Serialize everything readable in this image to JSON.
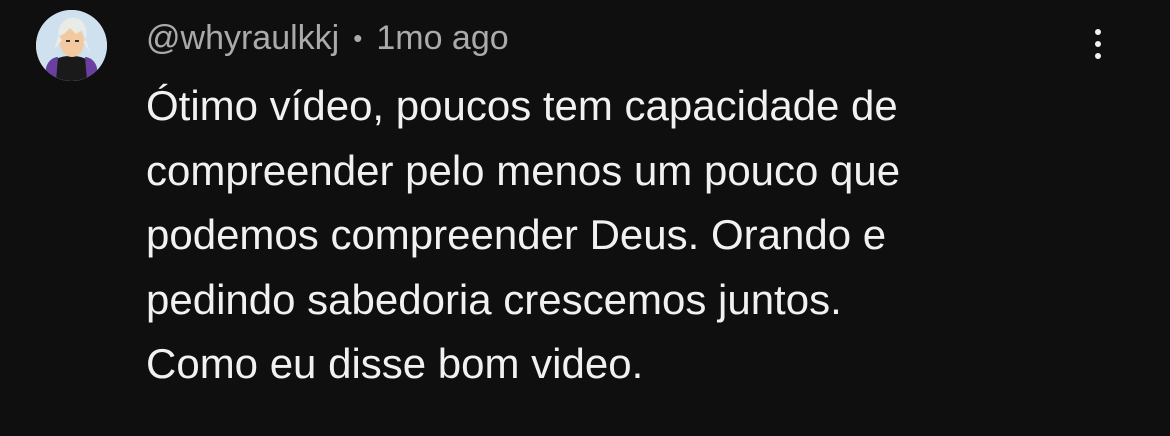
{
  "comment": {
    "author": "@whyraulkkj",
    "separator": "•",
    "timestamp": "1mo ago",
    "text": "Ótimo vídeo, poucos tem capacidade de\ncompreender pelo menos um pouco que\npodemos compreender Deus. Orando e\npedindo sabedoria crescemos juntos.\nComo eu disse bom video.",
    "menu_icon": "more-vertical-icon",
    "avatar_icon": "user-avatar"
  },
  "colors": {
    "background": "#0f0f0f",
    "primary_text": "#f1f1f1",
    "secondary_text": "#aaaaaa"
  }
}
